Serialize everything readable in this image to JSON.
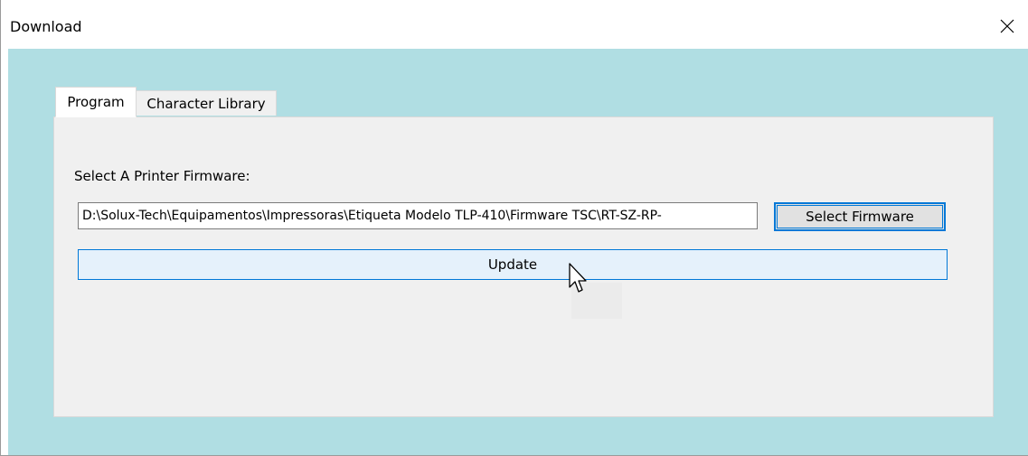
{
  "window": {
    "title": "Download",
    "close_icon": "close-icon"
  },
  "tabs": [
    {
      "label": "Program",
      "active": true
    },
    {
      "label": "Character Library",
      "active": false
    }
  ],
  "program_tab": {
    "firmware_label": "Select A Printer Firmware:",
    "firmware_path": "D:\\Solux-Tech\\Equipamentos\\Impressoras\\Etiqueta Modelo TLP-410\\Firmware TSC\\RT-SZ-RP-",
    "select_button_label": "Select Firmware",
    "update_button_label": "Update"
  },
  "colors": {
    "client_background": "#b0dee3",
    "accent": "#0078d7",
    "panel_background": "#f0f0f0"
  }
}
